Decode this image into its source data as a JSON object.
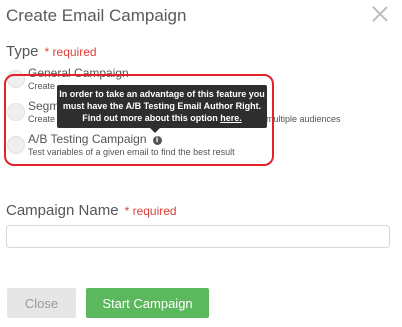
{
  "modal": {
    "title": "Create Email Campaign"
  },
  "type_section": {
    "label": "Type",
    "required": "* required",
    "options": [
      {
        "title": "General Campaign",
        "description": "Create"
      },
      {
        "title": "Segm",
        "description": "Create",
        "description_tail": "multiple audiences"
      },
      {
        "title": "A/B Testing Campaign",
        "description": "Test variables of a given email to find the best result",
        "info_icon": "info-icon"
      }
    ]
  },
  "tooltip": {
    "text": "In order to take an advantage of this feature you must have the A/B Testing Email Author Right. Find out more about this option",
    "link": "here."
  },
  "name_section": {
    "label": "Campaign Name",
    "required": "* required",
    "value": ""
  },
  "buttons": {
    "close": "Close",
    "start": "Start Campaign"
  },
  "colors": {
    "required": "#e0413c",
    "highlight": "#e2222a",
    "start_button": "#5cb85c",
    "tooltip_bg": "#2e2e2e"
  }
}
